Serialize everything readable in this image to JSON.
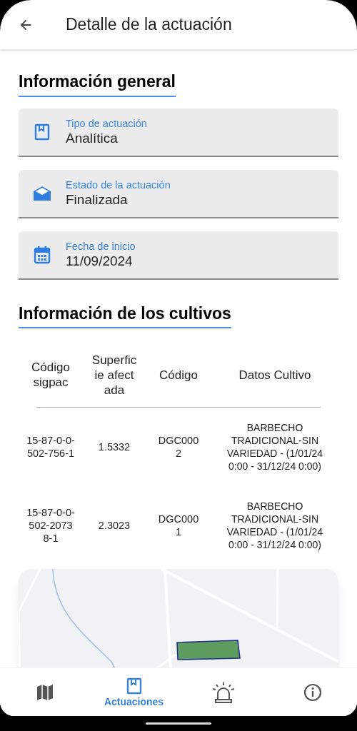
{
  "app_bar": {
    "title": "Detalle de la actuación"
  },
  "general": {
    "heading": "Información general",
    "fields": [
      {
        "kind": "book",
        "label": "Tipo de actuación",
        "value": "Analítica"
      },
      {
        "kind": "envelope",
        "label": "Estado de la actuación",
        "value": "Finalizada"
      },
      {
        "kind": "calendar",
        "label": "Fecha de inicio",
        "value": "11/09/2024"
      }
    ]
  },
  "crops": {
    "heading": "Información de los cultivos",
    "table": {
      "columns": [
        "Código sigpac",
        "Superficie afectada",
        "Código",
        "Datos Cultivo"
      ],
      "rows": [
        [
          "15-87-0-0-502-756-1",
          "1.5332",
          "DGC0002",
          "BARBECHO TRADICIONAL-SIN VARIEDAD - (1/01/24 0:00 - 31/12/24 0:00)"
        ],
        [
          "15-87-0-0-502-20738-1",
          "2.3023",
          "DGC0001",
          "BARBECHO TRADICIONAL-SIN VARIEDAD - (1/01/24 0:00 - 31/12/24 0:00)"
        ]
      ]
    }
  },
  "bottom_nav": [
    {
      "kind": "map",
      "selected": false
    },
    {
      "kind": "book",
      "label": "Actuaciones",
      "selected": true
    },
    {
      "kind": "alarm",
      "selected": false
    },
    {
      "kind": "info",
      "selected": false
    }
  ]
}
